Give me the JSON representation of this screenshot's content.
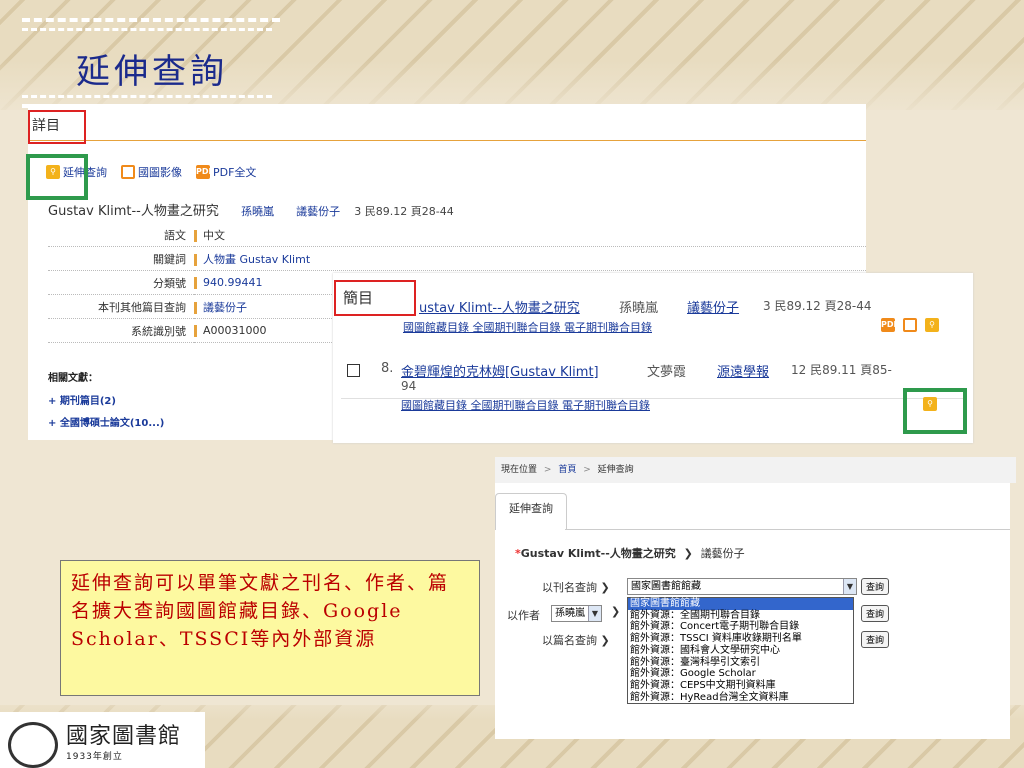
{
  "slide": {
    "title": "延伸查詢"
  },
  "panel1": {
    "tab_label": "詳目",
    "tools": [
      {
        "icon": "search-icon",
        "label": "延伸查詢"
      },
      {
        "icon": "document-icon",
        "label": "國圖影像"
      },
      {
        "icon": "pdf-icon",
        "label": "PDF全文"
      }
    ],
    "record": {
      "title": "Gustav Klimt--人物畫之研究",
      "author": "孫曉嵐",
      "journal": "議藝份子",
      "meta": "3   民89.12   頁28-44"
    },
    "fields": [
      {
        "key": "語文",
        "value": "中文"
      },
      {
        "key": "關鍵詞",
        "value": "人物畫 Gustav Klimt"
      },
      {
        "key": "分類號",
        "value": "940.99441"
      },
      {
        "key": "本刊其他篇目查詢",
        "value": "議藝份子"
      },
      {
        "key": "系統識別號",
        "value": "A00031000"
      }
    ],
    "related_heading": "相關文獻：",
    "related_items": [
      "+ 期刊篇目(2)",
      "+ 全國博碩士論文(10...)"
    ]
  },
  "panel2": {
    "tab_label": "簡目",
    "row1": {
      "title": "ustav Klimt--人物畫之研究",
      "author": "孫曉嵐",
      "journal": "議藝份子",
      "meta": "3   民89.12   頁28-44",
      "links": "國圖館藏目錄 全國期刊聯合目錄 電子期刊聯合目錄"
    },
    "row2": {
      "num": "8.",
      "title": "金碧輝煌的克林姆[Gustav Klimt]",
      "author": "文夢霞",
      "journal": "源遠學報",
      "meta": "12   民89.11   頁85-",
      "meta2": "94",
      "links": "國圖館藏目錄 全國期刊聯合目錄 電子期刊聯合目錄"
    }
  },
  "panel3": {
    "breadcrumb_label": "現在位置",
    "breadcrumb_home": "首頁",
    "breadcrumb_current": "延伸查詢",
    "tab_label": "延伸查詢",
    "heading_star": "*",
    "heading_title": "Gustav Klimt--人物畫之研究",
    "heading_journal": "議藝份子",
    "by_journal_label": "以刊名查詢",
    "by_author_label": "以作者",
    "author_select": "孫曉嵐",
    "by_title_label": "以篇名查詢",
    "source_select": "國家圖書館館藏",
    "query_label": "查詢",
    "source_options": [
      "國家圖書館館藏",
      "館外資源：全國期刊聯合目錄",
      "館外資源：Concert電子期刊聯合目錄",
      "館外資源：TSSCI 資料庫收錄期刊名單",
      "館外資源：國科會人文學研究中心",
      "館外資源：臺灣科學引文索引",
      "館外資源：Google Scholar",
      "館外資源：CEPS中文期刊資料庫",
      "館外資源：HyRead台灣全文資料庫"
    ]
  },
  "callout": {
    "text": "延伸查詢可以單筆文獻之刊名、作者、篇名擴大查詢國圖館藏目錄、Google Scholar、TSSCI等內外部資源"
  },
  "logo": {
    "name": "國家圖書館",
    "founded": "1933年創立"
  },
  "colors": {
    "title": "#1b2a8c",
    "link": "#1a3a9a",
    "highlight_box": "#2e9a4c",
    "tab_box": "#d22",
    "callout_bg": "#fdf9a0",
    "callout_text": "#b00"
  }
}
